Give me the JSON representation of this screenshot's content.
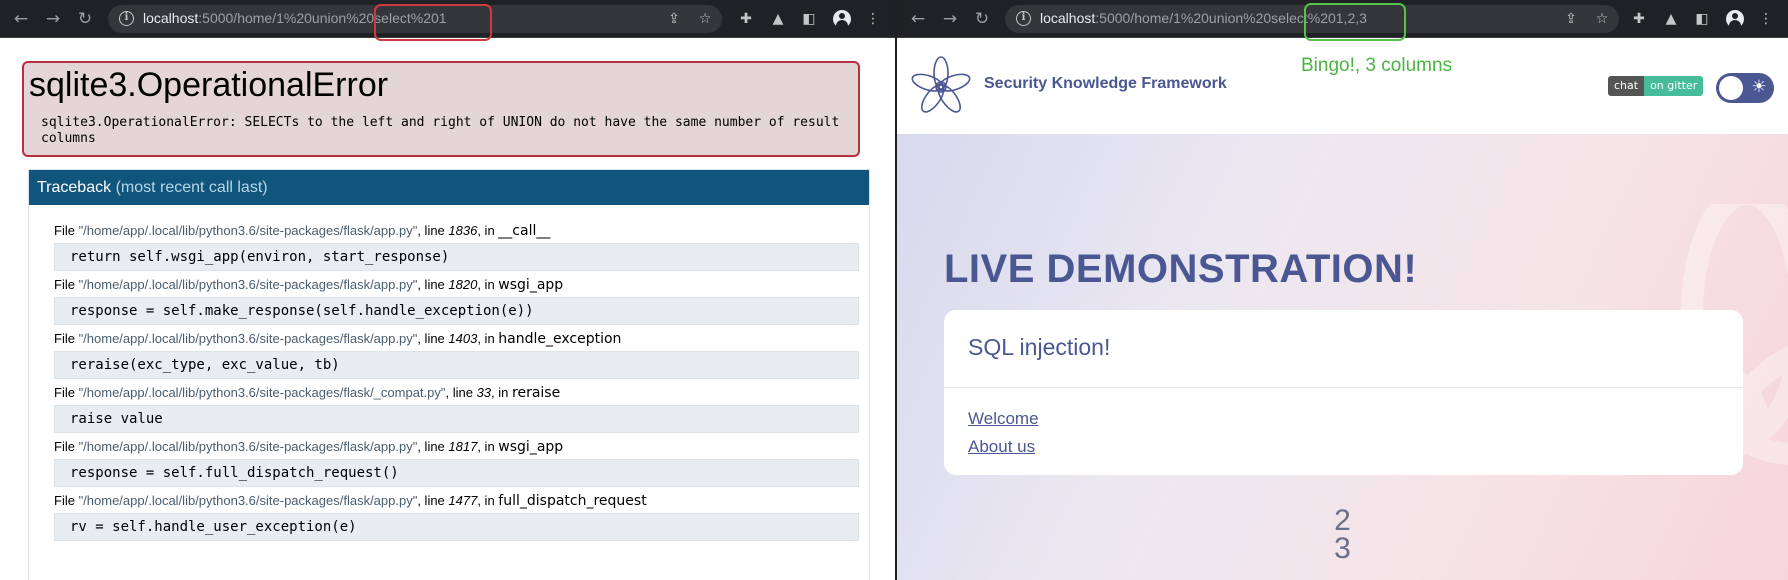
{
  "left_browser": {
    "url_host": "localhost",
    "url_path": ":5000/home/1%20union%20select%201",
    "error": {
      "title": "sqlite3.OperationalError",
      "message": "sqlite3.OperationalError: SELECTs to the left and right of UNION do not have the same number of result columns"
    },
    "traceback": {
      "title": "Traceback",
      "subtitle": "(most recent call last)",
      "frames": [
        {
          "prefix": "File ",
          "file": "\"/home/app/.local/lib/python3.6/site-packages/flask/app.py\"",
          "line_label": ", line ",
          "line": "1836",
          "in_label": ", in ",
          "func": "__call__",
          "code": "return self.wsgi_app(environ, start_response)"
        },
        {
          "prefix": "File ",
          "file": "\"/home/app/.local/lib/python3.6/site-packages/flask/app.py\"",
          "line_label": ", line ",
          "line": "1820",
          "in_label": ", in ",
          "func": "wsgi_app",
          "code": "response = self.make_response(self.handle_exception(e))"
        },
        {
          "prefix": "File ",
          "file": "\"/home/app/.local/lib/python3.6/site-packages/flask/app.py\"",
          "line_label": ", line ",
          "line": "1403",
          "in_label": ", in ",
          "func": "handle_exception",
          "code": "reraise(exc_type, exc_value, tb)"
        },
        {
          "prefix": "File ",
          "file": "\"/home/app/.local/lib/python3.6/site-packages/flask/_compat.py\"",
          "line_label": ", line ",
          "line": "33",
          "in_label": ", in ",
          "func": "reraise",
          "code": "raise value"
        },
        {
          "prefix": "File ",
          "file": "\"/home/app/.local/lib/python3.6/site-packages/flask/app.py\"",
          "line_label": ", line ",
          "line": "1817",
          "in_label": ", in ",
          "func": "wsgi_app",
          "code": "response = self.full_dispatch_request()"
        },
        {
          "prefix": "File ",
          "file": "\"/home/app/.local/lib/python3.6/site-packages/flask/app.py\"",
          "line_label": ", line ",
          "line": "1477",
          "in_label": ", in ",
          "func": "full_dispatch_request",
          "code": "rv = self.handle_user_exception(e)"
        }
      ]
    }
  },
  "right_browser": {
    "url_host": "localhost",
    "url_path": ":5000/home/1%20union%20select%201,2,3",
    "brand": "Security Knowledge Framework",
    "chat_badge": {
      "left": "chat",
      "right": "on gitter"
    },
    "headline": "LIVE DEMONSTRATION!",
    "card": {
      "title": "SQL injection!",
      "links": [
        "Welcome",
        "About us"
      ]
    },
    "results": [
      "2",
      "3"
    ]
  },
  "annotation": {
    "text": "Bingo!, 3 columns",
    "red_color": "#d0393d",
    "green_color": "#54c24b"
  },
  "icons": {
    "back": "back-arrow-icon",
    "forward": "forward-arrow-icon",
    "reload": "reload-icon",
    "info": "info-icon",
    "share": "share-icon",
    "bookmark": "star-icon",
    "extensions": "puzzle-icon",
    "lab": "flask-icon",
    "sidebar": "sidebar-icon",
    "profile": "avatar-icon",
    "menu": "kebab-menu-icon",
    "theme": "sun-icon"
  },
  "colors": {
    "brand": "#4a5793",
    "traceback_header": "#11557c",
    "error_border": "#b92f3f",
    "gitter": "#46bc99"
  }
}
